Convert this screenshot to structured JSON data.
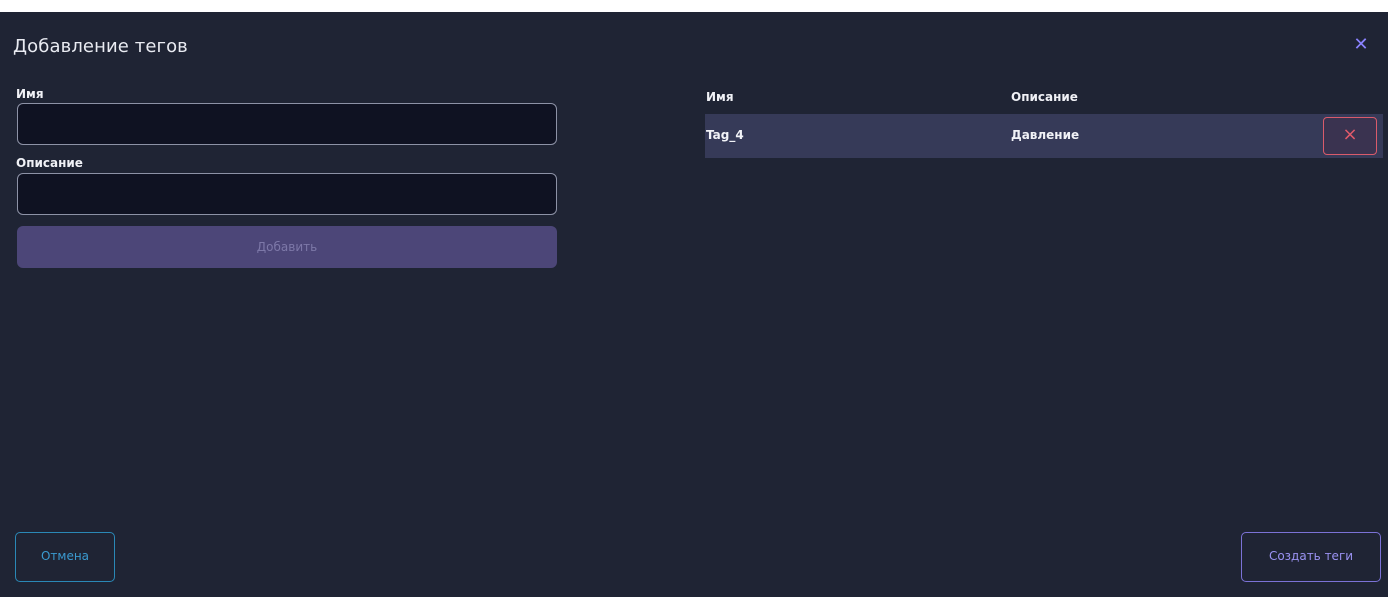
{
  "dialog": {
    "title": "Добавление тегов",
    "close_icon": "close-icon"
  },
  "form": {
    "name_label": "Имя",
    "name_value": "",
    "description_label": "Описание",
    "description_value": "",
    "add_label": "Добавить"
  },
  "table": {
    "columns": [
      "Имя",
      "Описание"
    ],
    "rows": [
      {
        "name": "Tag_4",
        "description": "Давление",
        "delete_icon": "close-icon"
      }
    ]
  },
  "footer": {
    "cancel_label": "Отмена",
    "create_label": "Создать теги"
  },
  "colors": {
    "background": "#1f2434",
    "accent": "#8a82ff",
    "danger": "#e25a6a",
    "cancel": "#3a9ad0"
  }
}
